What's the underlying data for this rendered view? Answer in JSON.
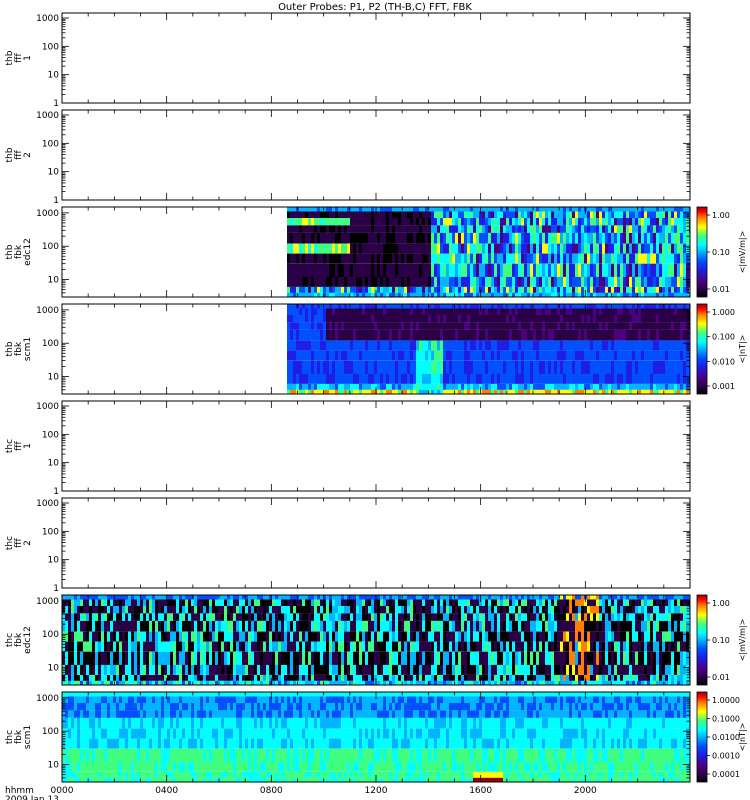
{
  "title": "Outer Probes: P1, P2 (TH-B,C) FFT, FBK",
  "colors": {
    "frame": "#000000",
    "background": "#ffffff",
    "colormap": [
      "#000000",
      "#2a0046",
      "#4b0082",
      "#1e1ee6",
      "#0050ff",
      "#00b4ff",
      "#00ffff",
      "#40ff80",
      "#ffff00",
      "#ff8000",
      "#ff0000",
      "#960000"
    ]
  },
  "chart_data": {
    "type": "heatmap",
    "x_axis": {
      "label": [
        "hhmm",
        "2009 Jan 13"
      ],
      "ticks": [
        "0000",
        "0400",
        "0800",
        "1200",
        "1600",
        "2000"
      ],
      "range_hours": [
        0,
        24
      ]
    },
    "panels": [
      {
        "ylabel": [
          "thb",
          "fff",
          "1"
        ],
        "yscale": "log",
        "ylim": [
          1,
          1500
        ],
        "yticks": [
          "1000",
          "100",
          "10",
          "1"
        ],
        "data": "none"
      },
      {
        "ylabel": [
          "thb",
          "fff",
          "2"
        ],
        "yscale": "log",
        "ylim": [
          1,
          1500
        ],
        "yticks": [
          "1000",
          "100",
          "10",
          "1"
        ],
        "data": "none"
      },
      {
        "ylabel": [
          "thb",
          "fbk",
          "edc12"
        ],
        "yscale": "log",
        "ylim": [
          3,
          1500
        ],
        "yticks": [
          "1000",
          "100",
          "10"
        ],
        "data_start_hour": 8.6,
        "colorbar": {
          "label": "<|mV/m|>",
          "ticks": [
            "1.00",
            "0.10",
            "0.01"
          ],
          "scale": "log"
        }
      },
      {
        "ylabel": [
          "thb",
          "fbk",
          "scm1"
        ],
        "yscale": "log",
        "ylim": [
          3,
          1500
        ],
        "yticks": [
          "1000",
          "100",
          "10"
        ],
        "data_start_hour": 8.6,
        "colorbar": {
          "label": "<|nT|>",
          "ticks": [
            "1.000",
            "0.100",
            "0.010",
            "0.001"
          ],
          "scale": "log"
        }
      },
      {
        "ylabel": [
          "thc",
          "fff",
          "1"
        ],
        "yscale": "log",
        "ylim": [
          1,
          1500
        ],
        "yticks": [
          "1000",
          "100",
          "10",
          "1"
        ],
        "data": "none"
      },
      {
        "ylabel": [
          "thc",
          "fff",
          "2"
        ],
        "yscale": "log",
        "ylim": [
          1,
          1500
        ],
        "yticks": [
          "1000",
          "100",
          "10",
          "1"
        ],
        "data": "none"
      },
      {
        "ylabel": [
          "thc",
          "fbk",
          "edc12"
        ],
        "yscale": "log",
        "ylim": [
          3,
          1500
        ],
        "yticks": [
          "1000",
          "100",
          "10"
        ],
        "data_start_hour": 0,
        "colorbar": {
          "label": "<|mV/m|>",
          "ticks": [
            "1.00",
            "0.10",
            "0.01"
          ],
          "scale": "log"
        }
      },
      {
        "ylabel": [
          "thc",
          "fbk",
          "scm1"
        ],
        "yscale": "log",
        "ylim": [
          3,
          1500
        ],
        "yticks": [
          "1000",
          "100",
          "10"
        ],
        "data_start_hour": 0,
        "colorbar": {
          "label": "<|nT|>",
          "ticks": [
            "1.0000",
            "0.1000",
            "0.0100",
            "0.0010",
            "0.0001"
          ],
          "scale": "log"
        }
      }
    ]
  }
}
